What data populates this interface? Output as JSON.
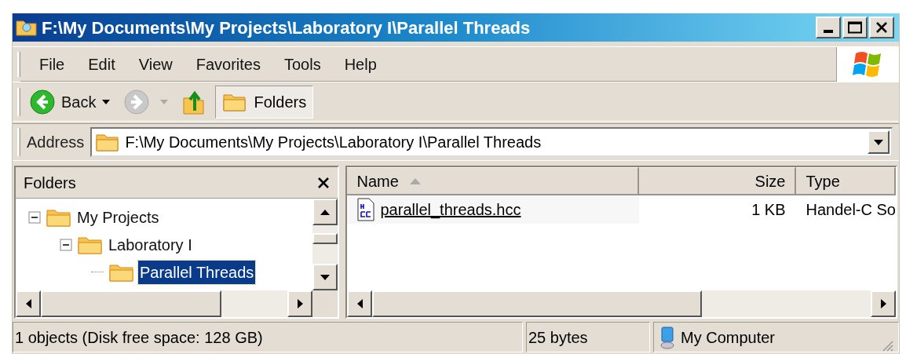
{
  "window": {
    "title": "F:\\My Documents\\My Projects\\Laboratory I\\Parallel Threads"
  },
  "menu": [
    "File",
    "Edit",
    "View",
    "Favorites",
    "Tools",
    "Help"
  ],
  "toolbar": {
    "back": {
      "label": "Back",
      "disabled": false
    },
    "forward": {
      "disabled": true
    },
    "folders": {
      "label": "Folders",
      "selected": true
    }
  },
  "address": {
    "label": "Address",
    "value": "F:\\My Documents\\My Projects\\Laboratory I\\Parallel Threads"
  },
  "folders_pane": {
    "title": "Folders",
    "tree": [
      {
        "label": "My Projects",
        "expanded": true,
        "selected": false,
        "children": [
          {
            "label": "Laboratory I",
            "expanded": true,
            "selected": false,
            "children": [
              {
                "label": "Parallel Threads",
                "selected": true
              }
            ]
          }
        ]
      }
    ]
  },
  "file_list": {
    "columns": [
      {
        "label": "Name",
        "sorted": true
      },
      {
        "label": "Size",
        "sorted": false
      },
      {
        "label": "Type",
        "sorted": false
      }
    ],
    "rows": [
      {
        "name": "parallel_threads.hcc",
        "size": "1 KB",
        "type": "Handel-C So"
      }
    ]
  },
  "status_bar": [
    "1 objects (Disk free space: 128 GB)",
    "25 bytes",
    "My Computer"
  ]
}
